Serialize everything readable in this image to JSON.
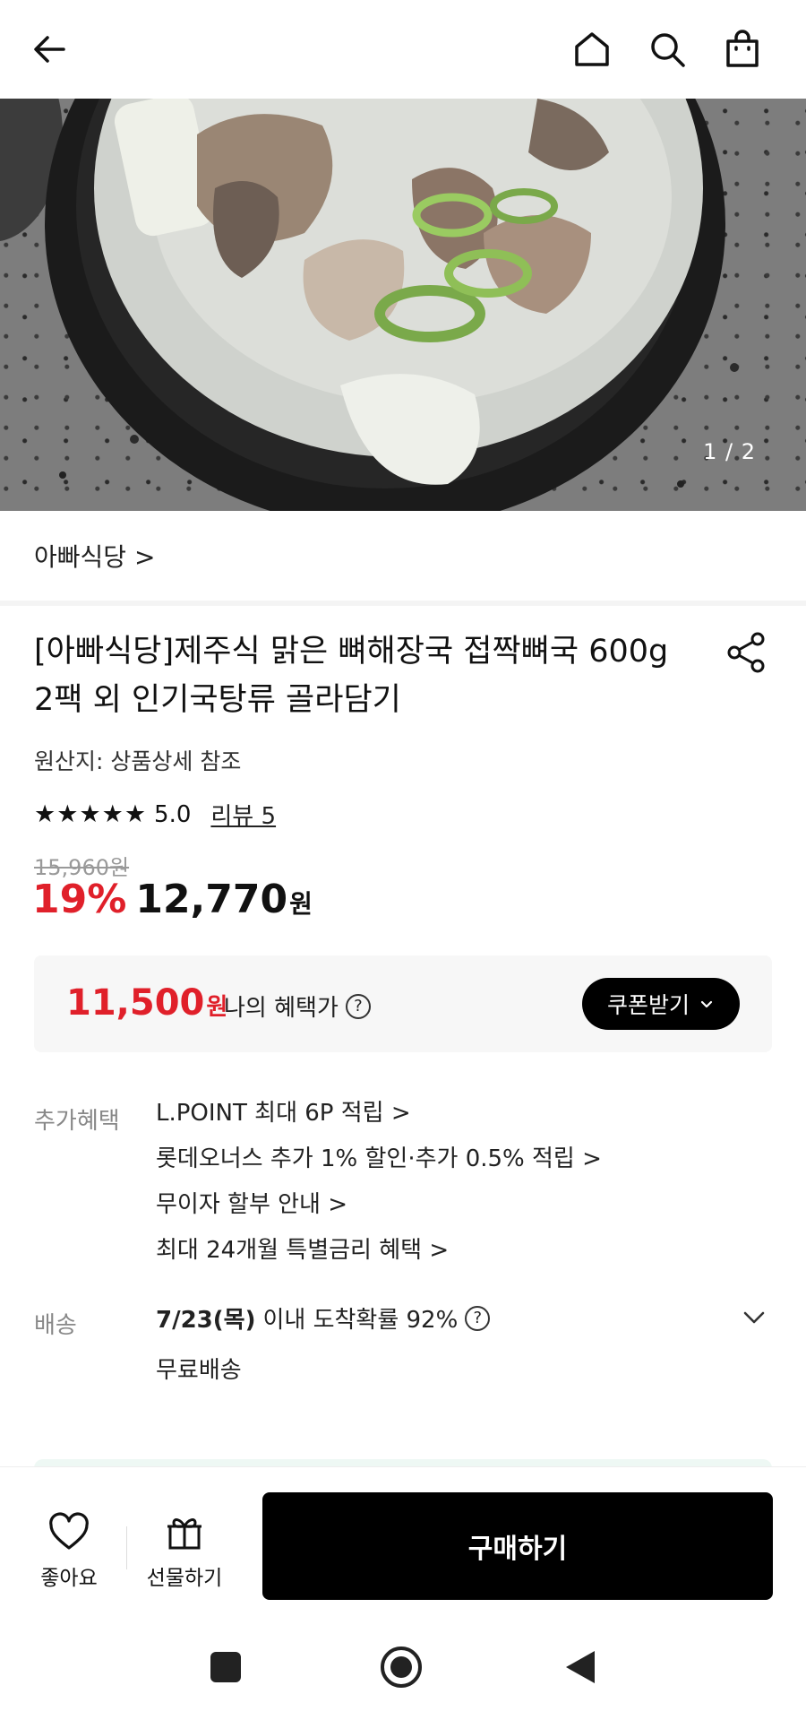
{
  "header": {
    "back_icon": "arrow-left-icon",
    "home_icon": "home-icon",
    "search_icon": "search-icon",
    "cart_icon": "shopping-bag-icon"
  },
  "hero": {
    "pager": "1 / 2"
  },
  "store": {
    "name": "아빠식당 >"
  },
  "product": {
    "title": "[아빠식당]제주식 맑은 뼈해장국 접짝뼈국 600g 2팩 외 인기국탕류 골라담기",
    "origin": "원산지: 상품상세 참조",
    "stars": "★★★★★",
    "rating": "5.0",
    "review_label": "리뷰 5",
    "original_price": "15,960원",
    "discount": "19%",
    "price": "12,770",
    "currency": "원"
  },
  "benefit": {
    "price": "11,500",
    "currency": "원",
    "label": "나의 혜택가",
    "help": "?",
    "coupon_button": "쿠폰받기"
  },
  "extra_benefits": {
    "label": "추가혜택",
    "items": [
      "L.POINT 최대 6P 적립 >",
      "롯데오너스 추가 1% 할인·추가 0.5% 적립 >",
      "무이자 할부 안내 >",
      "최대 24개월 특별금리 혜택 >"
    ]
  },
  "shipping": {
    "label": "배송",
    "date": "7/23(목)",
    "text": "이내 도착확률 92%",
    "help": "?",
    "fee": "무료배송"
  },
  "bottom_bar": {
    "like_label": "좋아요",
    "gift_label": "선물하기",
    "buy_label": "구매하기"
  },
  "colors": {
    "accent_red": "#e0202a",
    "button_black": "#000000"
  }
}
